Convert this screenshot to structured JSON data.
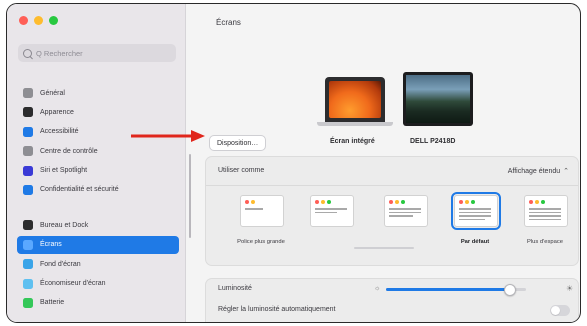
{
  "sidebar": {
    "search_placeholder": "Q Rechercher",
    "items": [
      {
        "label": "Général",
        "icon": "gear-icon",
        "color": "#8e8e93"
      },
      {
        "label": "Apparence",
        "icon": "appearance-icon",
        "color": "#2c2c2e"
      },
      {
        "label": "Accessibilité",
        "icon": "accessibility-icon",
        "color": "#1f7ae6"
      },
      {
        "label": "Centre de contrôle",
        "icon": "control-center-icon",
        "color": "#8e8e93"
      },
      {
        "label": "Siri et Spotlight",
        "icon": "siri-icon",
        "color": "#3a3ad6"
      },
      {
        "label": "Confidentialité et sécurité",
        "icon": "privacy-hand-icon",
        "color": "#1f7ae6"
      },
      {
        "label": "Bureau et Dock",
        "icon": "dock-icon",
        "color": "#2c2c2e"
      },
      {
        "label": "Écrans",
        "icon": "displays-icon",
        "color": "#1f7ae6",
        "selected": true
      },
      {
        "label": "Fond d'écran",
        "icon": "wallpaper-icon",
        "color": "#3aa4e8"
      },
      {
        "label": "Économiseur d'écran",
        "icon": "screensaver-icon",
        "color": "#5fc0f0"
      },
      {
        "label": "Batterie",
        "icon": "battery-icon",
        "color": "#34c759"
      }
    ]
  },
  "main": {
    "title": "Écrans",
    "arrange_button": "Disposition…",
    "displays": [
      {
        "label": "Écran intégré"
      },
      {
        "label": "DELL P2418D"
      }
    ],
    "use_as_label": "Utiliser comme",
    "use_as_value": "Affichage étendu",
    "resolutions": [
      {
        "label": "Police plus grande",
        "selected": false
      },
      {
        "label": "",
        "selected": false
      },
      {
        "label": "",
        "selected": false
      },
      {
        "label": "Par défaut",
        "selected": true
      },
      {
        "label": "Plus d'espace",
        "selected": false
      }
    ],
    "brightness_label": "Luminosité",
    "brightness_value": 0.88,
    "auto_brightness_label": "Régler la luminosité automatiquement",
    "auto_brightness_on": false
  },
  "colors": {
    "accent": "#1f7ae6",
    "annotation_arrow": "#e0261c"
  }
}
